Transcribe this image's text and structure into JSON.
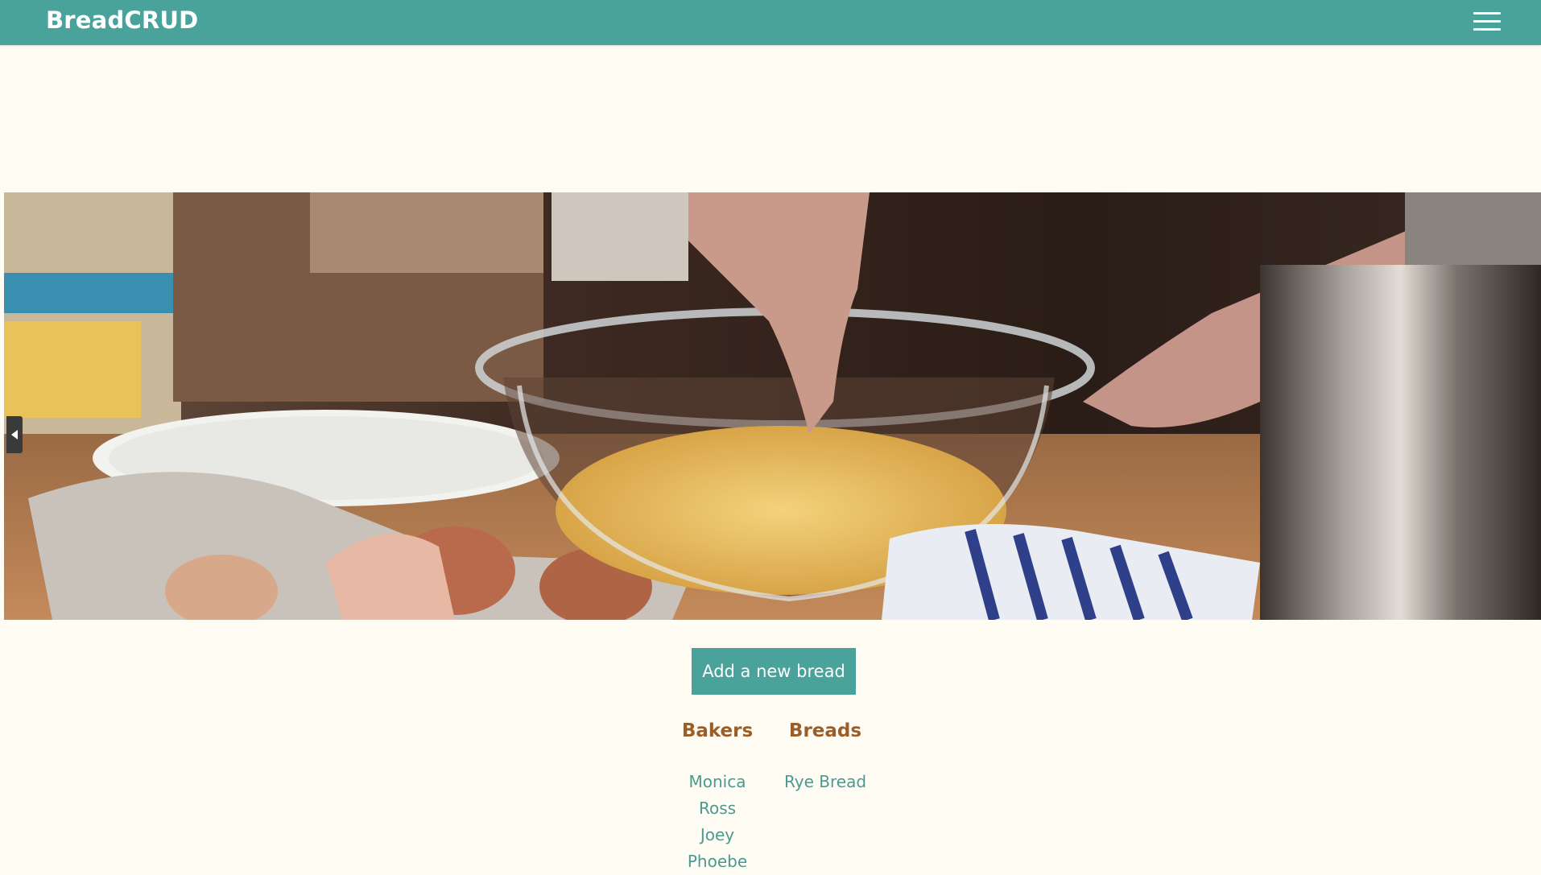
{
  "nav": {
    "brand": "BreadCRUD",
    "menu_icon": "hamburger-menu-icon"
  },
  "hero": {
    "image_description_icon": "hero-image",
    "prev_icon": "chevron-left-icon"
  },
  "actions": {
    "add_label": "Add a new bread"
  },
  "bakers": {
    "title": "Bakers",
    "items": [
      "Monica",
      "Ross",
      "Joey",
      "Phoebe"
    ]
  },
  "breads": {
    "title": "Breads",
    "items": [
      "Rye Bread"
    ]
  },
  "colors": {
    "navbar": "#4aa39a",
    "background": "#fffcf4",
    "heading": "#9a5f29",
    "link": "#4a9a92"
  }
}
